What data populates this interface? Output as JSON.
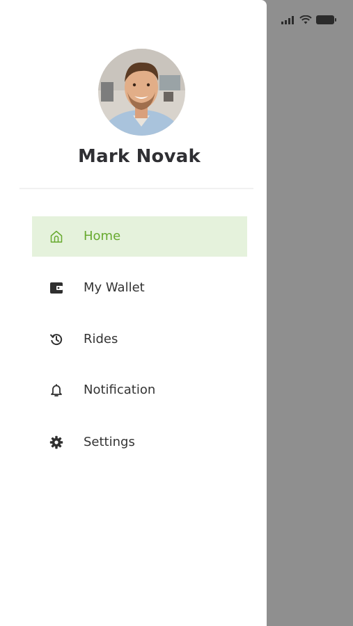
{
  "profile": {
    "name": "Mark Novak"
  },
  "menu": {
    "items": [
      {
        "label": "Home",
        "icon": "home-icon",
        "active": true
      },
      {
        "label": "My Wallet",
        "icon": "wallet-icon",
        "active": false
      },
      {
        "label": "Rides",
        "icon": "history-icon",
        "active": false
      },
      {
        "label": "Notification",
        "icon": "bell-icon",
        "active": false
      },
      {
        "label": "Settings",
        "icon": "gear-icon",
        "active": false
      }
    ]
  },
  "status_bar": {
    "icons": [
      "signal-icon",
      "wifi-icon",
      "battery-icon"
    ]
  },
  "colors": {
    "accent": "#67a92e",
    "active_bg": "#e5f2dc",
    "scrim": "#8f8f8f",
    "text": "#333333"
  }
}
